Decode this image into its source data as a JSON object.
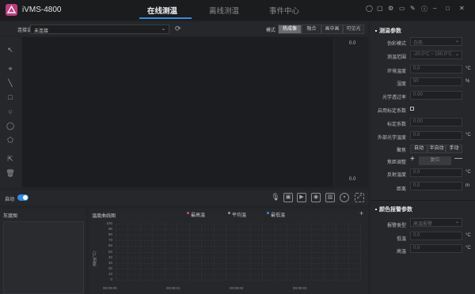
{
  "app": {
    "title": "iVMS-4800"
  },
  "nav": {
    "tabs": [
      {
        "label": "在线测温",
        "active": true
      },
      {
        "label": "离线测温",
        "active": false
      },
      {
        "label": "事件中心",
        "active": false
      }
    ]
  },
  "colors": {
    "accent": "#2f8ee3",
    "logo": "#c23a7c",
    "legend_max": "#e0427c",
    "legend_avg": "#9a9a9a",
    "legend_min": "#2f8ee3"
  },
  "toolbar": {
    "device_label": "连接设备",
    "device_value": "未连接",
    "mode_label": "模式",
    "modes": [
      "热成像",
      "融合",
      "画中画",
      "可见光"
    ]
  },
  "scale": {
    "top": "0.0",
    "bottom": "0.0"
  },
  "controls": {
    "auto_label": "自动"
  },
  "bottom": {
    "grayscale_title": "灰度图",
    "curve_title": "温度曲线图",
    "legend": [
      "最高温",
      "平均温",
      "最低温"
    ],
    "yaxis_label": "温度(°C)",
    "y_ticks": [
      "100",
      "90",
      "80",
      "70",
      "60",
      "50",
      "40",
      "30",
      "20",
      "10",
      "0"
    ],
    "x_ticks": [
      "00:00:00",
      "00:00:01",
      "00:00:02",
      "00:00:03"
    ]
  },
  "params": {
    "title": "测温参数",
    "rows": [
      {
        "label": "伪彩模式",
        "value": "白热",
        "kind": "select"
      },
      {
        "label": "测温范围",
        "value": "-20.0°C ~ 150.0°C",
        "kind": "select"
      },
      {
        "label": "环境温度",
        "value": "0.0",
        "unit": "°C",
        "kind": "input"
      },
      {
        "label": "湿度",
        "value": "50",
        "unit": "%",
        "kind": "input"
      },
      {
        "label": "光学透过率",
        "value": "0.00",
        "kind": "input"
      },
      {
        "label": "启用标定系数",
        "kind": "checkbox"
      },
      {
        "label": "标定系数",
        "value": "0.00",
        "kind": "input"
      },
      {
        "label": "外部光学温度",
        "value": "0.0",
        "unit": "°C",
        "kind": "input"
      }
    ],
    "focus_label": "聚焦",
    "focus_buttons": [
      "自动",
      "半自动",
      "手动"
    ],
    "zoom_label": "焦距调整",
    "zoom_reset": "复位",
    "reflect_label": "反射温度",
    "reflect_value": "0.0",
    "reflect_unit": "°C",
    "distance_label": "距离",
    "distance_value": "0.0",
    "distance_unit": "m"
  },
  "alarm": {
    "title": "颜色报警参数",
    "type_label": "报警类型",
    "type_value": "高温报警",
    "low_label": "低温",
    "low_value": "0.0",
    "low_unit": "°C",
    "high_label": "高温",
    "high_value": "0.0",
    "high_unit": "°C"
  }
}
